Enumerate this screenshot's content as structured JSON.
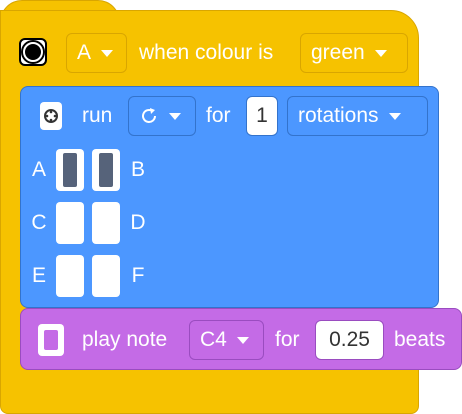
{
  "colors": {
    "hat": "#F6C200",
    "motor_block": "#4C97FF",
    "sound_block": "#C46BE6",
    "port_active": "#56637a"
  },
  "hat": {
    "icon": "color-sensor-icon",
    "port": "A",
    "text": "when colour is",
    "colour": "green"
  },
  "motor": {
    "icon": "motor-hub-icon",
    "run_label": "run",
    "direction_icon": "clockwise-icon",
    "for_label": "for",
    "amount": "1",
    "unit": "rotations",
    "ports": [
      {
        "label": "A",
        "active": true
      },
      {
        "label": "B",
        "active": true
      },
      {
        "label": "C",
        "active": false
      },
      {
        "label": "D",
        "active": false
      },
      {
        "label": "E",
        "active": false
      },
      {
        "label": "F",
        "active": false
      }
    ]
  },
  "sound": {
    "icon": "hub-speaker-icon",
    "play_label": "play note",
    "note": "C4",
    "for_label": "for",
    "beats_value": "0.25",
    "beats_label": "beats"
  }
}
